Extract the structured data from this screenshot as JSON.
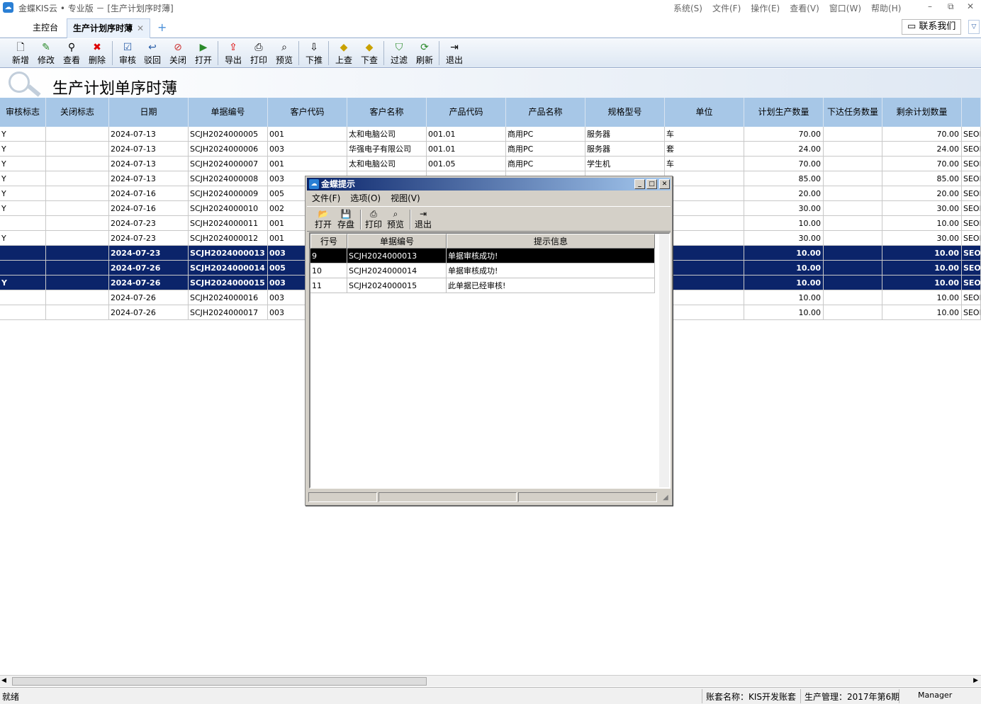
{
  "app": {
    "title": "金蝶KIS云 • 专业版 － [生产计划序时薄]",
    "icon": "cloud-icon",
    "menu": [
      "系统(S)",
      "文件(F)",
      "操作(E)",
      "查看(V)",
      "窗口(W)",
      "帮助(H)"
    ],
    "window_controls": {
      "minimize": "–",
      "restore": "⧉",
      "close": "✕"
    }
  },
  "tabs": {
    "home": "主控台",
    "active": "生产计划序时薄",
    "close_glyph": "✕",
    "add_glyph": "+"
  },
  "contact": {
    "label": "联系我们",
    "icon": "chat-icon",
    "collapse_glyph": "▽"
  },
  "toolbar": [
    {
      "label": "新增",
      "icon": "new-doc-icon",
      "glyph": "🗋"
    },
    {
      "label": "修改",
      "icon": "edit-icon",
      "glyph": "✎"
    },
    {
      "label": "查看",
      "icon": "binoculars-icon",
      "glyph": "⚲"
    },
    {
      "label": "删除",
      "icon": "delete-icon",
      "glyph": "✖"
    },
    {
      "label": "审核",
      "icon": "audit-icon",
      "glyph": "☑"
    },
    {
      "label": "驳回",
      "icon": "reject-icon",
      "glyph": "↩"
    },
    {
      "label": "关闭",
      "icon": "close-doc-icon",
      "glyph": "⊘"
    },
    {
      "label": "打开",
      "icon": "open-doc-icon",
      "glyph": "▶"
    },
    {
      "label": "导出",
      "icon": "export-icon",
      "glyph": "⇪"
    },
    {
      "label": "打印",
      "icon": "printer-icon",
      "glyph": "⎙"
    },
    {
      "label": "预览",
      "icon": "preview-icon",
      "glyph": "⌕"
    },
    {
      "label": "下推",
      "icon": "push-down-icon",
      "glyph": "⇩"
    },
    {
      "label": "上查",
      "icon": "up-query-icon",
      "glyph": "◆"
    },
    {
      "label": "下查",
      "icon": "down-query-icon",
      "glyph": "◆"
    },
    {
      "label": "过滤",
      "icon": "filter-icon",
      "glyph": "⛉"
    },
    {
      "label": "刷新",
      "icon": "refresh-icon",
      "glyph": "⟳"
    },
    {
      "label": "退出",
      "icon": "exit-icon",
      "glyph": "⇥"
    }
  ],
  "page_title": "生产计划单序时薄",
  "grid": {
    "columns": [
      "审核标志",
      "关闭标志",
      "日期",
      "单据编号",
      "客户代码",
      "客户名称",
      "产品代码",
      "产品名称",
      "规格型号",
      "单位",
      "计划生产数量",
      "下达任务数量",
      "剩余计划数量",
      ""
    ],
    "rows": [
      {
        "sel": false,
        "cells": [
          "Y",
          "",
          "2024-07-13",
          "SCJH2024000005",
          "001",
          "太和电脑公司",
          "001.01",
          "商用PC",
          "服务器",
          "车",
          "70.00",
          "",
          "70.00",
          "SEORD"
        ]
      },
      {
        "sel": false,
        "cells": [
          "Y",
          "",
          "2024-07-13",
          "SCJH2024000006",
          "003",
          "华强电子有限公司",
          "001.01",
          "商用PC",
          "服务器",
          "套",
          "24.00",
          "",
          "24.00",
          "SEORD"
        ]
      },
      {
        "sel": false,
        "cells": [
          "Y",
          "",
          "2024-07-13",
          "SCJH2024000007",
          "001",
          "太和电脑公司",
          "001.05",
          "商用PC",
          "学生机",
          "车",
          "70.00",
          "",
          "70.00",
          "SEORD"
        ]
      },
      {
        "sel": false,
        "cells": [
          "Y",
          "",
          "2024-07-13",
          "SCJH2024000008",
          "003",
          "",
          "",
          "",
          "",
          "",
          "85.00",
          "",
          "85.00",
          "SEORD"
        ]
      },
      {
        "sel": false,
        "cells": [
          "Y",
          "",
          "2024-07-16",
          "SCJH2024000009",
          "005",
          "",
          "",
          "",
          "",
          "",
          "20.00",
          "",
          "20.00",
          "SEORD"
        ]
      },
      {
        "sel": false,
        "cells": [
          "Y",
          "",
          "2024-07-16",
          "SCJH2024000010",
          "002",
          "",
          "",
          "",
          "",
          "",
          "30.00",
          "",
          "30.00",
          "SEORD"
        ]
      },
      {
        "sel": false,
        "cells": [
          "",
          "",
          "2024-07-23",
          "SCJH2024000011",
          "001",
          "",
          "",
          "",
          "",
          "",
          "10.00",
          "",
          "10.00",
          "SEORD"
        ]
      },
      {
        "sel": false,
        "cells": [
          "Y",
          "",
          "2024-07-23",
          "SCJH2024000012",
          "001",
          "",
          "",
          "",
          "",
          "",
          "30.00",
          "",
          "30.00",
          "SEORD"
        ]
      },
      {
        "sel": true,
        "cells": [
          "",
          "",
          "2024-07-23",
          "SCJH2024000013",
          "003",
          "",
          "",
          "",
          "",
          "",
          "10.00",
          "",
          "10.00",
          "SEOR"
        ]
      },
      {
        "sel": true,
        "cells": [
          "",
          "",
          "2024-07-26",
          "SCJH2024000014",
          "005",
          "",
          "",
          "",
          "",
          "",
          "10.00",
          "",
          "10.00",
          "SEOR"
        ]
      },
      {
        "sel": true,
        "cells": [
          "Y",
          "",
          "2024-07-26",
          "SCJH2024000015",
          "003",
          "",
          "",
          "",
          "",
          "",
          "10.00",
          "",
          "10.00",
          "SEOR"
        ]
      },
      {
        "sel": false,
        "cells": [
          "",
          "",
          "2024-07-26",
          "SCJH2024000016",
          "003",
          "",
          "",
          "",
          "",
          "",
          "10.00",
          "",
          "10.00",
          "SEORD"
        ]
      },
      {
        "sel": false,
        "cells": [
          "",
          "",
          "2024-07-26",
          "SCJH2024000017",
          "003",
          "",
          "",
          "",
          "",
          "",
          "10.00",
          "",
          "10.00",
          "SEORD"
        ]
      }
    ]
  },
  "scrollbar": {
    "left": "◀",
    "right": "▶"
  },
  "status": {
    "ready": "就绪",
    "account": "账套名称：KIS开发账套",
    "period": "生产管理：2017年第6期",
    "user": "Manager"
  },
  "dialog": {
    "title": "金蝶提示",
    "controls": {
      "minimize": "_",
      "maximize": "□",
      "close": "✕"
    },
    "menu": [
      "文件(F)",
      "选项(O)",
      "视图(V)"
    ],
    "toolbar": [
      {
        "label": "打开",
        "icon": "folder-open-icon",
        "glyph": "📂"
      },
      {
        "label": "存盘",
        "icon": "save-icon",
        "glyph": "💾"
      },
      {
        "label": "打印",
        "icon": "printer-icon",
        "glyph": "⎙"
      },
      {
        "label": "预览",
        "icon": "preview-icon",
        "glyph": "⌕"
      },
      {
        "label": "退出",
        "icon": "exit-icon",
        "glyph": "⇥"
      }
    ],
    "columns": [
      "行号",
      "单据编号",
      "提示信息"
    ],
    "rows": [
      {
        "sel": true,
        "cells": [
          "9",
          "SCJH2024000013",
          "单据审核成功!"
        ]
      },
      {
        "sel": false,
        "cells": [
          "10",
          "SCJH2024000014",
          "单据审核成功!"
        ]
      },
      {
        "sel": false,
        "cells": [
          "11",
          "SCJH2024000015",
          "此单据已经审核!"
        ]
      }
    ]
  }
}
